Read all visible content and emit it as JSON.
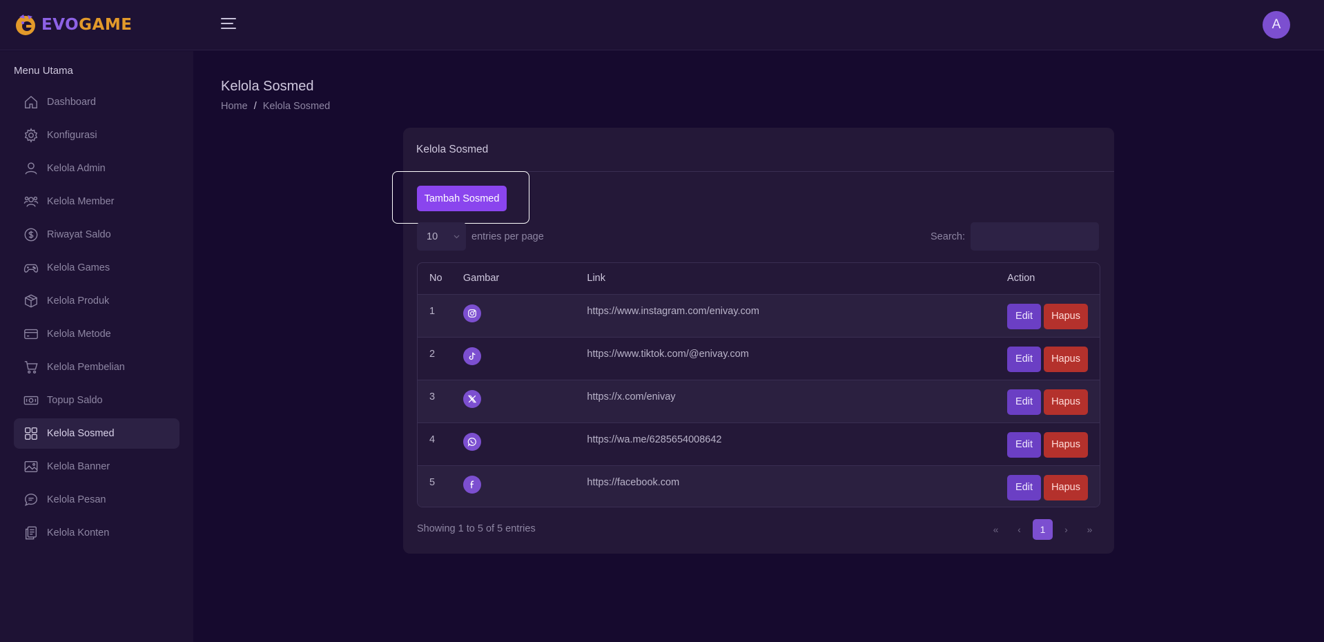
{
  "brand": {
    "part1": "EVO",
    "part2": "GAME"
  },
  "header": {
    "avatar_initial": "A"
  },
  "sidebar": {
    "title": "Menu Utama",
    "items": [
      {
        "label": "Dashboard",
        "icon": "home-icon"
      },
      {
        "label": "Konfigurasi",
        "icon": "gear-icon"
      },
      {
        "label": "Kelola Admin",
        "icon": "user-icon"
      },
      {
        "label": "Kelola Member",
        "icon": "users-icon"
      },
      {
        "label": "Riwayat Saldo",
        "icon": "dollar-icon"
      },
      {
        "label": "Kelola Games",
        "icon": "gamepad-icon"
      },
      {
        "label": "Kelola Produk",
        "icon": "box-icon"
      },
      {
        "label": "Kelola Metode",
        "icon": "credit-card-icon"
      },
      {
        "label": "Kelola Pembelian",
        "icon": "cart-icon"
      },
      {
        "label": "Topup Saldo",
        "icon": "money-icon"
      },
      {
        "label": "Kelola Sosmed",
        "icon": "grid-icon",
        "active": true
      },
      {
        "label": "Kelola Banner",
        "icon": "image-icon"
      },
      {
        "label": "Kelola Pesan",
        "icon": "message-icon"
      },
      {
        "label": "Kelola Konten",
        "icon": "document-icon"
      }
    ]
  },
  "page": {
    "title": "Kelola Sosmed",
    "breadcrumb": {
      "home": "Home",
      "separator": "/",
      "current": "Kelola Sosmed"
    }
  },
  "card": {
    "title": "Kelola Sosmed",
    "add_button": "Tambah Sosmed",
    "entries_value": "10",
    "entries_label": "entries per page",
    "search_label": "Search:",
    "search_value": "",
    "columns": {
      "no": "No",
      "image": "Gambar",
      "link": "Link",
      "action": "Action"
    },
    "rows": [
      {
        "no": "1",
        "icon": "instagram-icon",
        "link": "https://www.instagram.com/enivay.com"
      },
      {
        "no": "2",
        "icon": "tiktok-icon",
        "link": "https://www.tiktok.com/@enivay.com"
      },
      {
        "no": "3",
        "icon": "x-icon",
        "link": "https://x.com/enivay"
      },
      {
        "no": "4",
        "icon": "whatsapp-icon",
        "link": "https://wa.me/6285654008642"
      },
      {
        "no": "5",
        "icon": "facebook-icon",
        "link": "https://facebook.com"
      }
    ],
    "edit_label": "Edit",
    "delete_label": "Hapus",
    "info": "Showing 1 to 5 of 5 entries",
    "pagination": {
      "first": "«",
      "prev": "‹",
      "current": "1",
      "next": "›",
      "last": "»"
    }
  },
  "colors": {
    "background": "#160a2e",
    "panel": "#1e1234",
    "accent": "#8a45ee",
    "edit": "#6b3fc4",
    "delete": "#b4312c",
    "brand_evo": "#8d62e6",
    "brand_game": "#e39a2a"
  }
}
